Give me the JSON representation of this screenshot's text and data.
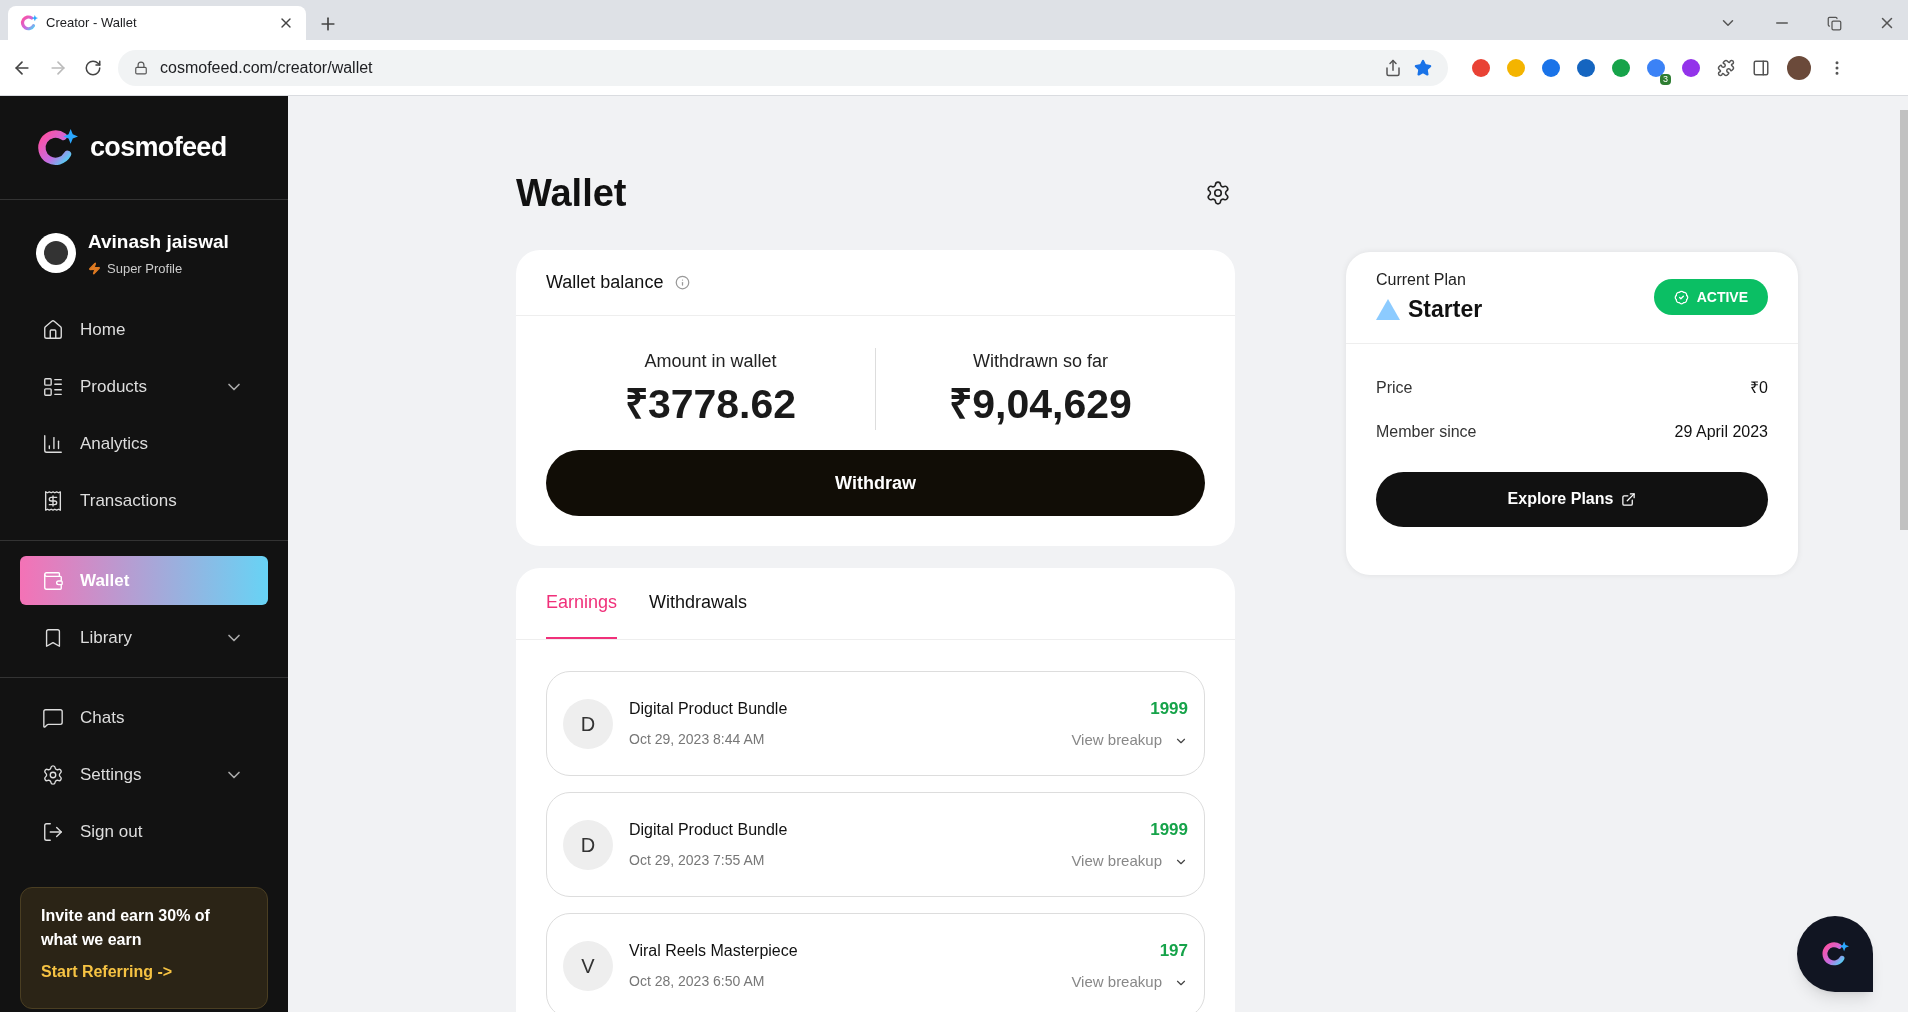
{
  "browser": {
    "tab_title": "Creator - Wallet",
    "url": "cosmofeed.com/creator/wallet",
    "extension_badge": "3"
  },
  "sidebar": {
    "brand": "cosmofeed",
    "profile": {
      "name": "Avinash jaiswal",
      "subtitle": "Super Profile"
    },
    "sections": [
      [
        {
          "label": "Home",
          "has_submenu": false,
          "selected": false
        },
        {
          "label": "Products",
          "has_submenu": true,
          "selected": false
        },
        {
          "label": "Analytics",
          "has_submenu": false,
          "selected": false
        },
        {
          "label": "Transactions",
          "has_submenu": false,
          "selected": false
        }
      ],
      [
        {
          "label": "Wallet",
          "has_submenu": false,
          "selected": true
        },
        {
          "label": "Library",
          "has_submenu": true,
          "selected": false
        }
      ],
      [
        {
          "label": "Chats",
          "has_submenu": false,
          "selected": false
        },
        {
          "label": "Settings",
          "has_submenu": true,
          "selected": false
        },
        {
          "label": "Sign out",
          "has_submenu": false,
          "selected": false
        }
      ]
    ],
    "invite": {
      "text": "Invite and earn 30% of what we earn",
      "link": "Start Referring ->"
    }
  },
  "page_title": "Wallet",
  "balance": {
    "title": "Wallet balance",
    "stats": [
      {
        "label": "Amount in wallet",
        "value": "₹3778.62"
      },
      {
        "label": "Withdrawn so far",
        "value": "₹9,04,629"
      }
    ],
    "button": "Withdraw"
  },
  "tabs": [
    {
      "label": "Earnings",
      "selected": true
    },
    {
      "label": "Withdrawals",
      "selected": false
    }
  ],
  "earnings": [
    {
      "initial": "D",
      "title": "Digital Product Bundle",
      "date": "Oct 29, 2023 8:44 AM",
      "amount": "1999",
      "action": "View breakup"
    },
    {
      "initial": "D",
      "title": "Digital Product Bundle",
      "date": "Oct 29, 2023 7:55 AM",
      "amount": "1999",
      "action": "View breakup"
    },
    {
      "initial": "V",
      "title": "Viral Reels Masterpiece",
      "date": "Oct 28, 2023 6:50 AM",
      "amount": "197",
      "action": "View breakup"
    }
  ],
  "plan": {
    "caption": "Current Plan",
    "name": "Starter",
    "status": "ACTIVE",
    "details": [
      {
        "label": "Price",
        "value": "₹0"
      },
      {
        "label": "Member since",
        "value": "29 April 2023"
      }
    ],
    "button": "Explore Plans"
  }
}
